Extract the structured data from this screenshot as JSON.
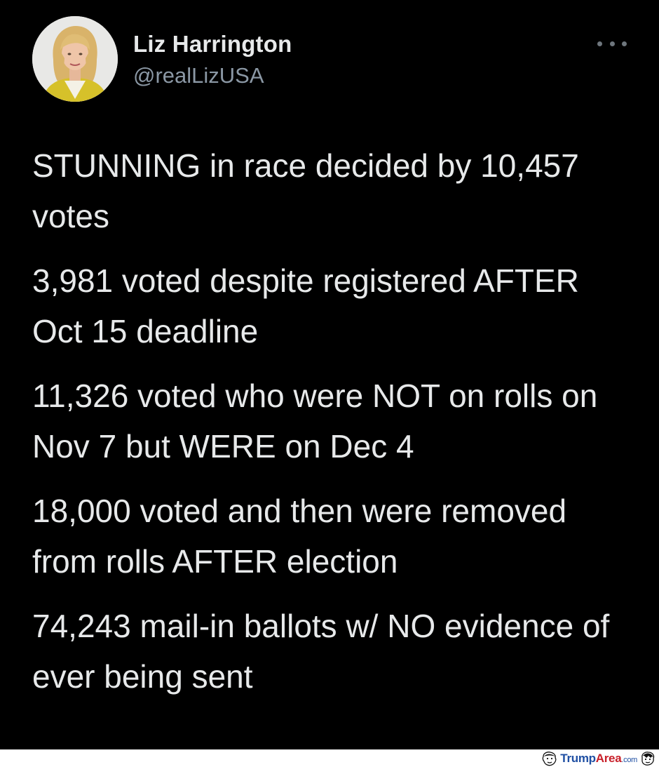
{
  "tweet": {
    "author": {
      "display_name": "Liz Harrington",
      "handle": "@realLizUSA",
      "avatar_icon": "profile-photo"
    },
    "more_icon": "more-horizontal-icon",
    "paragraphs": [
      "STUNNING in race decided by 10,457 votes",
      "3,981 voted despite registered AFTER Oct 15 deadline",
      "11,326 voted who were NOT on rolls on Nov 7 but WERE on Dec 4",
      "18,000 voted and then were removed from rolls AFTER election",
      "74,243 mail-in ballots w/ NO evidence of ever being sent"
    ]
  },
  "watermark": {
    "part1": "Trump",
    "part2": "Area",
    "part3": ".com"
  },
  "colors": {
    "background": "#000000",
    "text_primary": "#e7e9ea",
    "text_secondary": "#8b98a5",
    "watermark_blue": "#1f4fa3",
    "watermark_red": "#c8202a"
  }
}
